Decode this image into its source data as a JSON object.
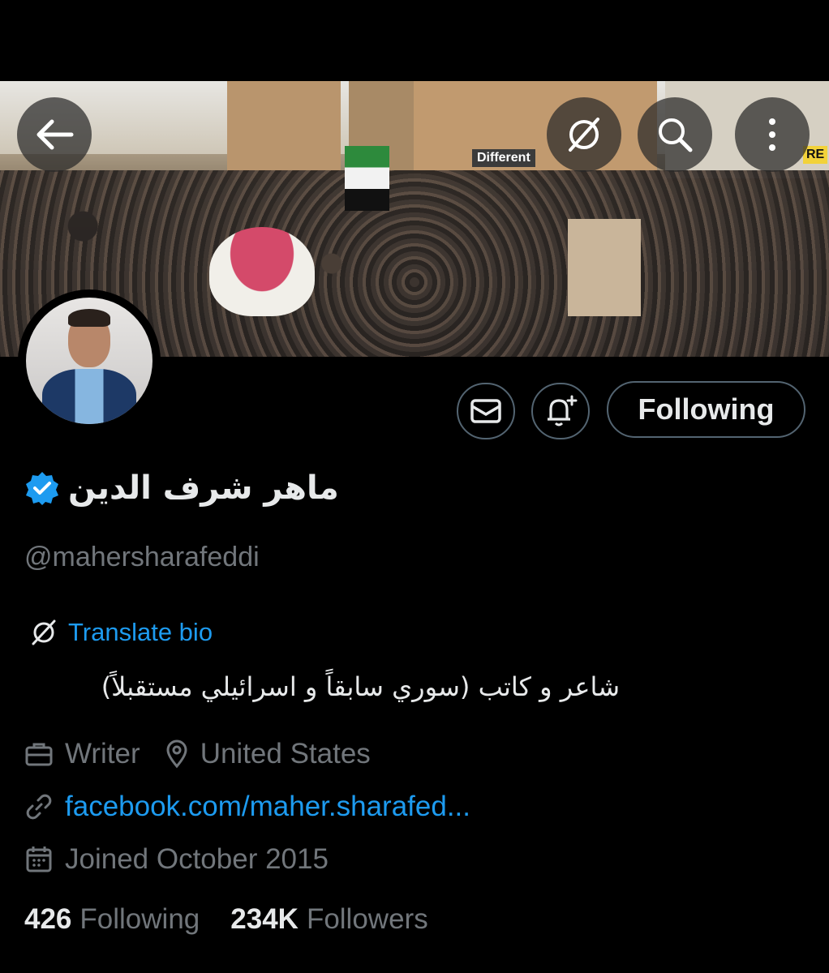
{
  "header": {
    "back_icon": "arrow-left-icon",
    "translate_icon": "translate-icon",
    "search_icon": "search-icon",
    "more_icon": "more-vertical-icon"
  },
  "banner": {
    "sign_text": "Different",
    "corner_sign": "RE"
  },
  "profile": {
    "display_name": "ماهر شرف الدين",
    "verified_color": "#1d9bf0",
    "handle": "@mahersharafeddi",
    "translate_label": "Translate bio",
    "bio": "شاعر و كاتب (سوري سابقاً و اسرائيلي مستقبلاً)",
    "occupation": "Writer",
    "location": "United States",
    "link": "facebook.com/maher.sharafed...",
    "joined": "Joined October 2015"
  },
  "actions": {
    "message_icon": "mail-icon",
    "notify_icon": "bell-plus-icon",
    "following_label": "Following"
  },
  "stats": {
    "following_count": "426",
    "following_label": "Following",
    "followers_count": "234K",
    "followers_label": "Followers"
  },
  "colors": {
    "background": "#000000",
    "accent": "#1d9bf0",
    "muted": "#71767b",
    "border": "#536471"
  }
}
